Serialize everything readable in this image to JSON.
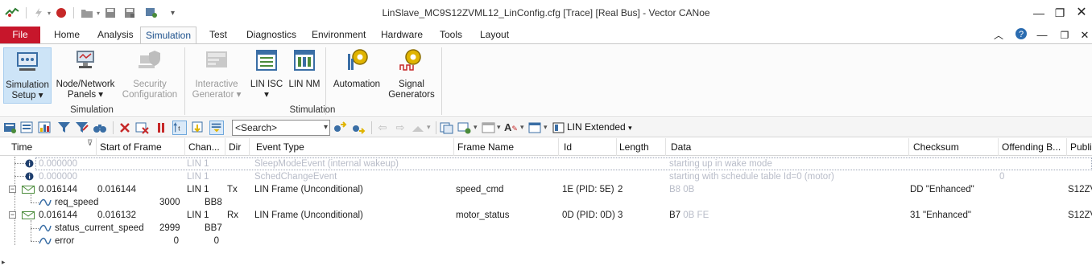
{
  "window": {
    "title": "LinSlave_MC9S12ZVML12_LinConfig.cfg [Trace] [Real Bus] - Vector CANoe"
  },
  "tabs": [
    {
      "label": "File"
    },
    {
      "label": "Home"
    },
    {
      "label": "Analysis"
    },
    {
      "label": "Simulation",
      "active": true
    },
    {
      "label": "Test"
    },
    {
      "label": "Diagnostics"
    },
    {
      "label": "Environment"
    },
    {
      "label": "Hardware"
    },
    {
      "label": "Tools"
    },
    {
      "label": "Layout"
    }
  ],
  "ribbon": {
    "simulation_group": "Simulation",
    "stimulation_group": "Stimulation",
    "sim_setup_1": "Simulation",
    "sim_setup_2": "Setup",
    "node_net_1": "Node/Network",
    "node_net_2": "Panels",
    "security_1": "Security",
    "security_2": "Configuration",
    "interactive_1": "Interactive",
    "interactive_2": "Generator",
    "lin_isc": "LIN ISC",
    "lin_nm": "LIN NM",
    "automation": "Automation",
    "signal_gen_1": "Signal",
    "signal_gen_2": "Generators"
  },
  "toolbar": {
    "search_placeholder": "<Search>",
    "view_label": "LIN Extended"
  },
  "table": {
    "columns": [
      "Time",
      "Start of Frame",
      "Chan...",
      "Dir",
      "Event Type",
      "Frame Name",
      "Id",
      "Length",
      "Data",
      "Checksum",
      "Offending B...",
      "Publi"
    ],
    "rows": [
      {
        "time": "0.000000",
        "chan": "LIN 1",
        "event": "SleepModeEvent (internal wakeup)",
        "data": "starting up in wake mode"
      },
      {
        "time": "0.000000",
        "chan": "LIN 1",
        "event": "SchedChangeEvent",
        "data": "starting with schedule table Id=0 (motor)",
        "offending": "0"
      },
      {
        "time": "0.016144",
        "sof": "0.016144",
        "chan": "LIN 1",
        "dir": "Tx",
        "event": "LIN Frame (Unconditional)",
        "frame": "speed_cmd",
        "id": "1E (PID: 5E)",
        "length": "2",
        "data": "B8 0B",
        "checksum": "DD \"Enhanced\"",
        "publisher": "S12ZV"
      },
      {
        "signal": "req_speed",
        "value": "3000",
        "raw": "BB8"
      },
      {
        "time": "0.016144",
        "sof": "0.016132",
        "chan": "LIN 1",
        "dir": "Rx",
        "event": "LIN Frame (Unconditional)",
        "frame": "motor_status",
        "id": "0D (PID: 0D)",
        "length": "3",
        "data_hl": "B7",
        "data_rest": "0B FE",
        "checksum": "31 \"Enhanced\"",
        "publisher": "S12ZV"
      },
      {
        "signal": "status_current_speed",
        "value": "2999",
        "raw": "BB7"
      },
      {
        "signal": "error",
        "value": "0",
        "raw": "0"
      }
    ]
  },
  "colors": {
    "file_tab": "#c7162b",
    "active_tab_text": "#1a4f8b",
    "selected_button": "#cde4f7",
    "gray_text": "#b8bcc8"
  }
}
